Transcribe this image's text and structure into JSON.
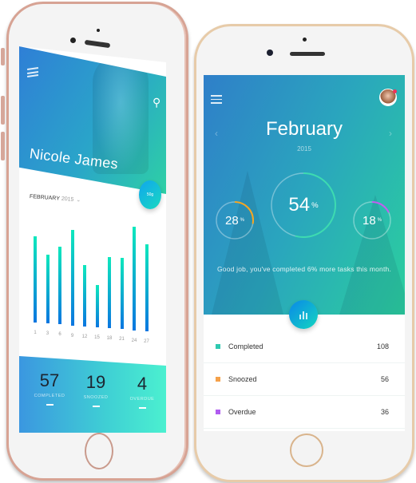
{
  "left_phone": {
    "profile_name": "Nicole James",
    "month_label": "FEBRUARY",
    "year_label": "2015",
    "fab_label": "50g",
    "chart_data": {
      "type": "bar",
      "title": "",
      "xlabel": "",
      "ylabel": "",
      "categories": [
        "1",
        "3",
        "6",
        "9",
        "12",
        "15",
        "18",
        "21",
        "24",
        "27"
      ],
      "values": [
        83,
        66,
        75,
        92,
        59,
        41,
        69,
        69,
        100,
        84
      ],
      "ylim": [
        0,
        100
      ],
      "grid": false
    },
    "stats": [
      {
        "value": "57",
        "label": "COMPLETED"
      },
      {
        "value": "19",
        "label": "SNOOZED"
      },
      {
        "value": "4",
        "label": "OVERDUE"
      }
    ],
    "icons": {
      "menu": "hamburger-icon",
      "search": "search-icon",
      "dropdown": "chevron-down-icon"
    }
  },
  "right_phone": {
    "month": "February",
    "year": "2015",
    "prev_arrow": "‹",
    "next_arrow": "›",
    "rings": [
      {
        "name": "snoozed",
        "value": "28",
        "percent": 28,
        "unit": "%",
        "color": "#f5a623"
      },
      {
        "name": "completed",
        "value": "54",
        "percent": 54,
        "unit": "%",
        "color": "#3ddbb0"
      },
      {
        "name": "overdue",
        "value": "18",
        "percent": 18,
        "unit": "%",
        "color": "#c45cf0"
      }
    ],
    "message": "Good job, you've completed 6% more tasks this month.",
    "list": [
      {
        "label": "Completed",
        "count": "108",
        "color": "#2ec9b0"
      },
      {
        "label": "Snoozed",
        "count": "56",
        "color": "#f5a14a"
      },
      {
        "label": "Overdue",
        "count": "36",
        "color": "#b05cf0"
      }
    ],
    "icons": {
      "menu": "hamburger-icon",
      "avatar": "avatar",
      "fab": "bar-chart-icon"
    }
  }
}
